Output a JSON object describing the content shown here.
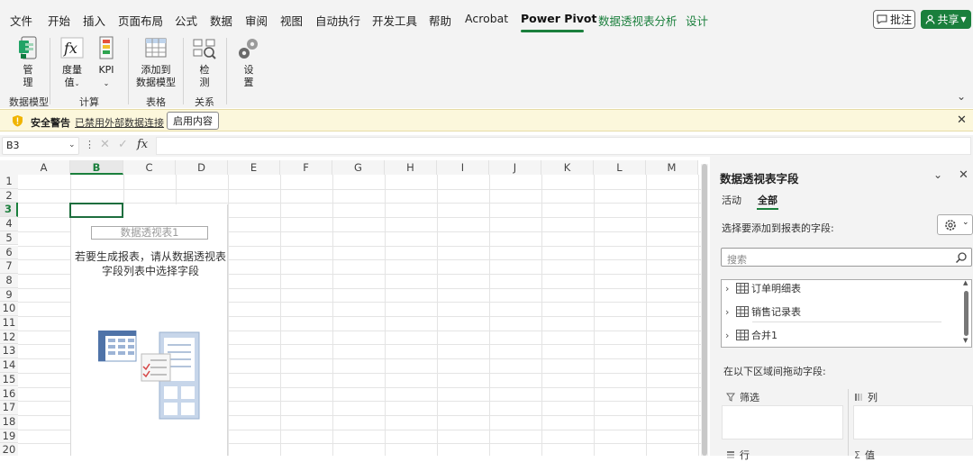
{
  "menu": {
    "items": [
      "文件",
      "开始",
      "插入",
      "页面布局",
      "公式",
      "数据",
      "审阅",
      "视图",
      "自动执行",
      "开发工具",
      "帮助",
      "Acrobat",
      "Power Pivot",
      "数据透视表分析",
      "设计"
    ],
    "active_index": 12,
    "contextual_indices": [
      13,
      14
    ],
    "comment_label": "批注",
    "share_label": "共享"
  },
  "ribbon": {
    "manage": "管\n理",
    "measures": "度量\n值",
    "kpi": "KPI",
    "add_to_model": "添加到\n数据模型",
    "detect": "检\n测",
    "settings": "设\n置",
    "groups": [
      "数据模型",
      "计算",
      "表格",
      "关系"
    ]
  },
  "security": {
    "title": "安全警告",
    "message": "已禁用外部数据连接",
    "enable_label": "启用内容"
  },
  "formula_bar": {
    "name_box": "B3",
    "fx": "fx",
    "formula": ""
  },
  "grid": {
    "columns": [
      "A",
      "B",
      "C",
      "D",
      "E",
      "F",
      "G",
      "H",
      "I",
      "J",
      "K",
      "L",
      "M"
    ],
    "rows": [
      "1",
      "2",
      "3",
      "4",
      "5",
      "6",
      "7",
      "8",
      "9",
      "10",
      "11",
      "12",
      "13",
      "14",
      "15",
      "16",
      "17",
      "18",
      "19",
      "20"
    ],
    "selected_col": "B",
    "selected_row": "3"
  },
  "pivot": {
    "name": "数据透视表1",
    "hint": "若要生成报表，请从数据透视表字段列表中选择字段"
  },
  "field_pane": {
    "title": "数据透视表字段",
    "tab_active": "活动",
    "tab_all": "全部",
    "choose_label": "选择要添加到报表的字段:",
    "search_placeholder": "搜索",
    "tables": [
      "订单明细表",
      "销售记录表",
      "合并1"
    ],
    "drag_label": "在以下区域间拖动字段:",
    "areas": [
      "筛选",
      "列",
      "行",
      "值"
    ]
  },
  "colors": {
    "accent_green": "#1a7f3c",
    "security_bg": "#fcf7dc"
  }
}
